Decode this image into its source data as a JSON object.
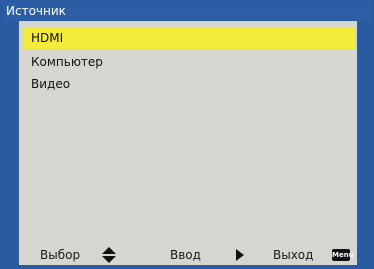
{
  "window": {
    "title": "Источник"
  },
  "source_list": {
    "items": [
      {
        "label": "HDMI",
        "selected": true
      },
      {
        "label": "Компьютер",
        "selected": false
      },
      {
        "label": "Видео",
        "selected": false
      }
    ]
  },
  "footer": {
    "select_label": "Выбор",
    "enter_label": "Ввод",
    "exit_label": "Выход",
    "menu_key_label": "Menu",
    "select_icon": "up-down-arrows-icon",
    "enter_icon": "play-right-arrow-icon"
  },
  "colors": {
    "frame": "#2a5aa0",
    "panel": "#d6d6d0",
    "highlight": "#f3ec3a"
  }
}
